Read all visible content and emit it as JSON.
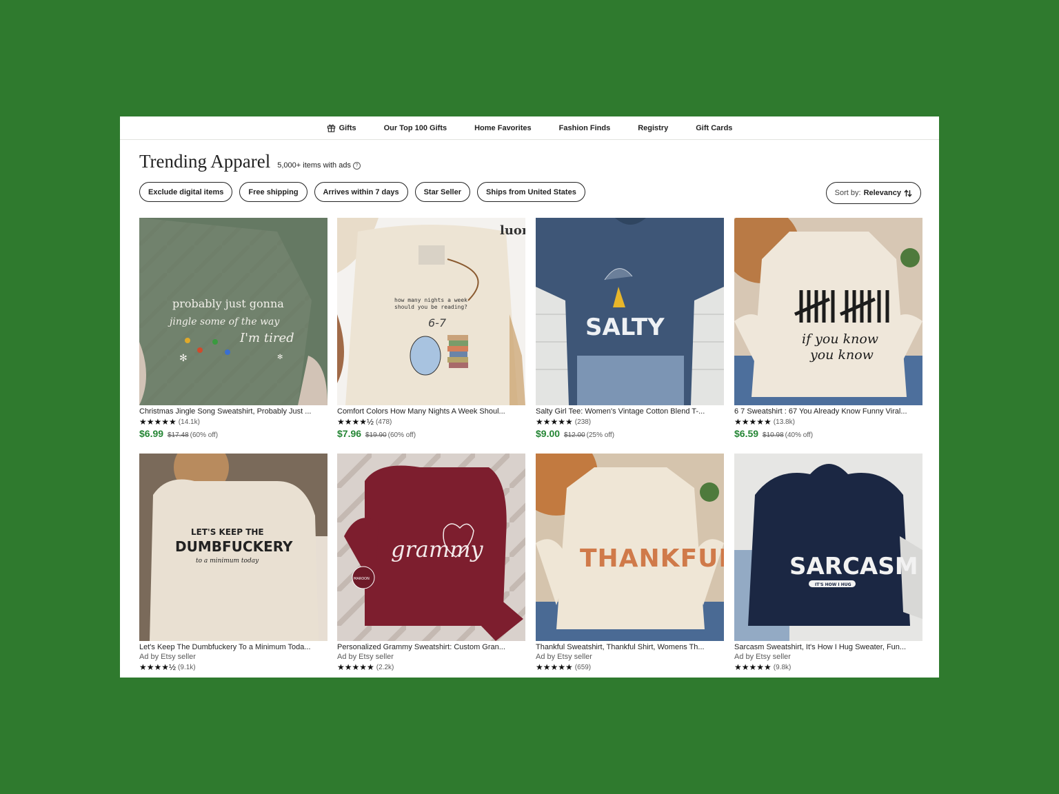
{
  "nav": {
    "items": [
      "Gifts",
      "Our Top 100 Gifts",
      "Home Favorites",
      "Fashion Finds",
      "Registry",
      "Gift Cards"
    ]
  },
  "header": {
    "title": "Trending Apparel",
    "count": "5,000+ items with ads",
    "info_icon": "info-circle-icon"
  },
  "filters": [
    "Exclude digital items",
    "Free shipping",
    "Arrives within 7 days",
    "Star Seller",
    "Ships from United States"
  ],
  "sort": {
    "label": "Sort by:",
    "value": "Relevancy",
    "icon": "sort-arrows-icon"
  },
  "colors": {
    "background": "#2f7a2e",
    "price": "#258635"
  },
  "products": [
    {
      "title": "Christmas Jingle Song Sweatshirt, Probably Just ...",
      "stars": "★★★★★",
      "reviews": "(14.1k)",
      "price": "$6.99",
      "original": "$17.48",
      "discount": "(60% off)",
      "image_text": [
        "probably just gonna",
        "jingle some of the way",
        "I'm tired"
      ]
    },
    {
      "title": "Comfort Colors How Many Nights A Week Shoul...",
      "stars": "★★★★½",
      "reviews": "(478)",
      "price": "$7.96",
      "original": "$19.90",
      "discount": "(60% off)",
      "image_text": [
        "how many nights a week",
        "should you be reading?",
        "6-7",
        "luor"
      ]
    },
    {
      "title": "Salty Girl Tee: Women's Vintage Cotton Blend T-...",
      "stars": "★★★★★",
      "reviews": "(238)",
      "price": "$9.00",
      "original": "$12.00",
      "discount": "(25% off)",
      "image_text": [
        "SALTY"
      ]
    },
    {
      "title": "6 7 Sweatshirt : 67 You Already Know Funny Viral...",
      "stars": "★★★★★",
      "reviews": "(13.8k)",
      "price": "$6.59",
      "original": "$10.98",
      "discount": "(40% off)",
      "image_text": [
        "if you know",
        "you know"
      ]
    },
    {
      "title": "Let's Keep The Dumbfuckery To a Minimum Toda...",
      "ad": "Ad by Etsy seller",
      "stars": "★★★★½",
      "reviews": "(9.1k)",
      "image_text": [
        "LET'S KEEP THE",
        "DUMBFUCKERY",
        "to a minimum today"
      ]
    },
    {
      "title": "Personalized Grammy Sweatshirt: Custom Gran...",
      "ad": "Ad by Etsy seller",
      "stars": "★★★★★",
      "reviews": "(2.2k)",
      "image_text": [
        "grammy",
        "MAROON"
      ]
    },
    {
      "title": "Thankful Sweatshirt, Thankful Shirt, Womens Th...",
      "ad": "Ad by Etsy seller",
      "stars": "★★★★★",
      "reviews": "(659)",
      "image_text": [
        "THANKFUL"
      ]
    },
    {
      "title": "Sarcasm Sweatshirt, It's How I Hug Sweater, Fun...",
      "ad": "Ad by Etsy seller",
      "stars": "★★★★★",
      "reviews": "(9.8k)",
      "image_text": [
        "SARCASM",
        "IT'S HOW I HUG"
      ]
    }
  ]
}
